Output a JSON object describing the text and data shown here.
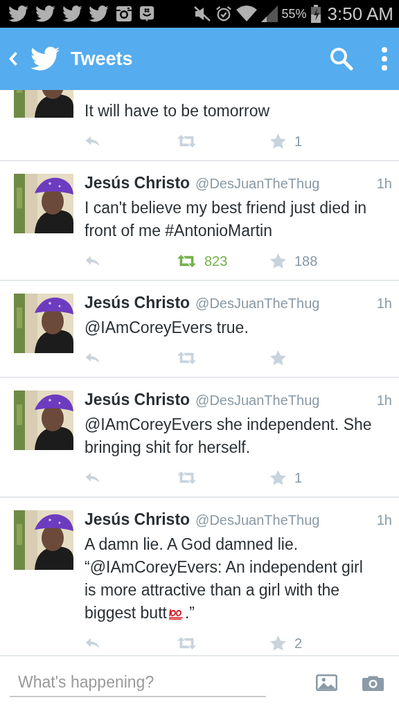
{
  "status_bar": {
    "battery": "55%",
    "time": "3:50 AM"
  },
  "header": {
    "title": "Tweets"
  },
  "tweets": [
    {
      "text": "It will have to be tomorrow",
      "retweeted": false,
      "favorites": "1"
    },
    {
      "name": "Jesús Christo",
      "handle": "@DesJuanTheThug",
      "time": "1h",
      "text": "I can't believe my best friend just died in front of me #AntonioMartin",
      "retweeted": true,
      "retweets": "823",
      "favorites": "188"
    },
    {
      "name": "Jesús Christo",
      "handle": "@DesJuanTheThug",
      "time": "1h",
      "text": "@IAmCoreyEvers true.",
      "retweeted": false
    },
    {
      "name": "Jesús Christo",
      "handle": "@DesJuanTheThug",
      "time": "1h",
      "text": "@IAmCoreyEvers she independent. She bringing shit for herself.",
      "retweeted": false,
      "favorites": "1"
    },
    {
      "name": "Jesús Christo",
      "handle": "@DesJuanTheThug",
      "time": "1h",
      "text": "A damn lie. A God damned lie. “@IAmCoreyEvers: An independent girl is more attractive than a girl with the",
      "text_end": "biggest butt",
      "emoji": {
        "kind": "hundred_points"
      },
      "text_after": ".”",
      "retweeted": false,
      "favorites": "2"
    }
  ],
  "compose": {
    "placeholder": "What's happening?"
  }
}
